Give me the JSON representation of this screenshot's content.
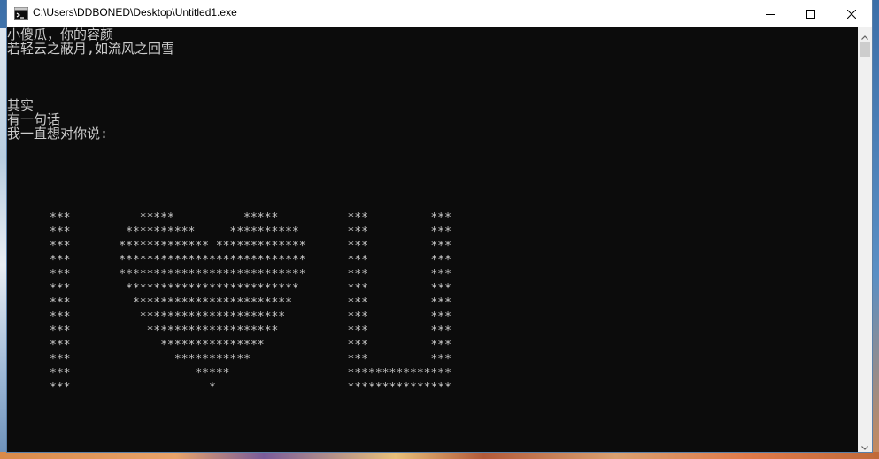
{
  "window": {
    "title": "C:\\Users\\DDBONED\\Desktop\\Untitled1.exe",
    "icons": {
      "app": "console-app-icon",
      "minimize": "minimize-icon",
      "maximize": "maximize-icon",
      "close": "close-icon"
    }
  },
  "console": {
    "lines": [
      "小傻瓜，你的容颜",
      "若轻云之蔽月,如流风之回雪",
      "",
      "",
      "",
      "其实",
      "有一句话",
      "我一直想对你说:"
    ],
    "art": [
      "***          *****          *****          ***         ***",
      "***        **********     **********       ***         ***",
      "***       ************* *************      ***         ***",
      "***       ***************************      ***         ***",
      "***       ***************************      ***         ***",
      "***        *************************       ***         ***",
      "***         ***********************        ***         ***",
      "***          *********************         ***         ***",
      "***           *******************          ***         ***",
      "***             ***************            ***         ***",
      "***               ***********              ***         ***",
      "***                  *****                 ***************",
      "***                    *                   ***************"
    ]
  },
  "scrollbar": {
    "up_icon": "scroll-up-arrow-icon",
    "down_icon": "scroll-down-arrow-icon"
  },
  "colors": {
    "console_bg": "#0c0c0c",
    "console_text": "#cccccc",
    "titlebar_bg": "#ffffff"
  }
}
